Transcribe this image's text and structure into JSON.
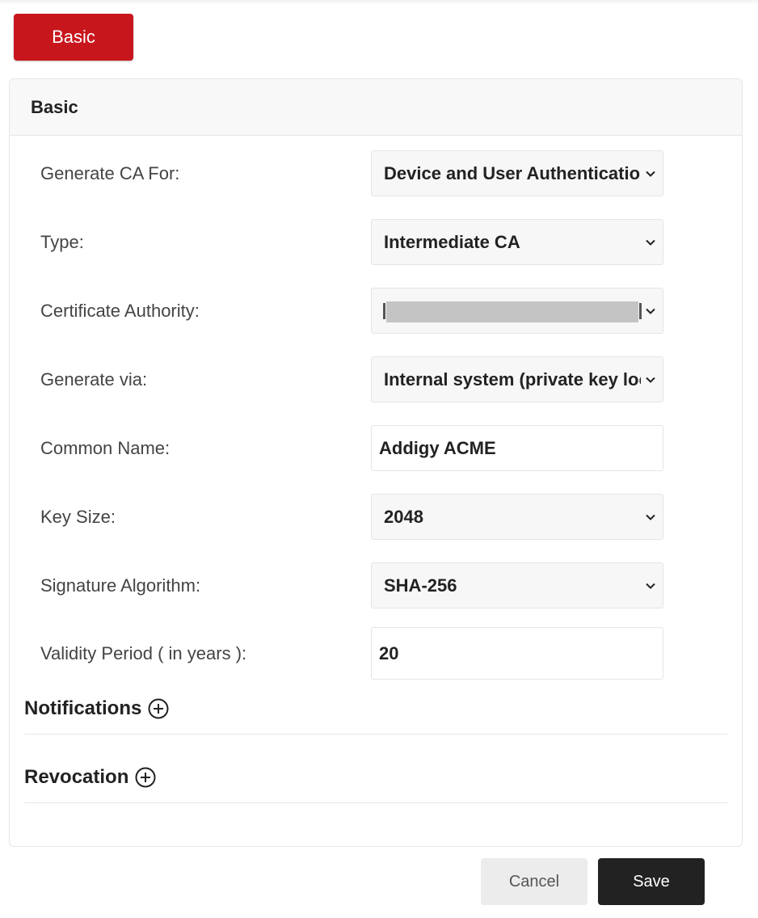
{
  "tab": {
    "label": "Basic"
  },
  "card": {
    "title": "Basic"
  },
  "fields": [
    {
      "label": "Generate CA For:",
      "value": "Device and User Authentication",
      "type": "select"
    },
    {
      "label": "Type:",
      "value": "Intermediate CA",
      "type": "select"
    },
    {
      "label": "Certificate Authority:",
      "value": "",
      "type": "select",
      "redacted": true
    },
    {
      "label": "Generate via:",
      "value": "Internal system (private key located on server)",
      "type": "select"
    },
    {
      "label": "Common Name:",
      "value": "Addigy ACME",
      "type": "input"
    },
    {
      "label": "Key Size:",
      "value": "2048",
      "type": "select"
    },
    {
      "label": "Signature Algorithm:",
      "value": "SHA-256",
      "type": "select"
    },
    {
      "label": "Validity Period ( in years ):",
      "value": "20",
      "type": "input"
    }
  ],
  "sections": [
    {
      "title": "Notifications",
      "icon": "plus-circle-icon"
    },
    {
      "title": "Revocation",
      "icon": "plus-circle-icon"
    }
  ],
  "buttons": {
    "cancel": "Cancel",
    "save": "Save"
  },
  "colors": {
    "accent": "#c8161d",
    "save_bg": "#222222",
    "cancel_bg": "#ececec"
  }
}
